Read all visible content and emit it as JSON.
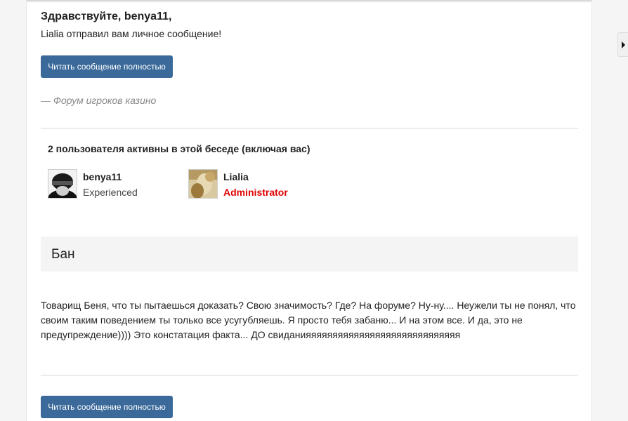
{
  "email": {
    "greeting": "Здравствуйте, benya11,",
    "intro": "Lialia отправил вам личное сообщение!",
    "read_button_label": "Читать сообщение полностью",
    "signature": "— Форум игроков казино"
  },
  "participants": {
    "title": "2 пользователя активны в этой беседе (включая вас)",
    "users": [
      {
        "name": "benya11",
        "title": "Experienced"
      },
      {
        "name": "Lialia",
        "title": "Administrator"
      }
    ]
  },
  "message": {
    "subject": "Бан",
    "body": "Товарищ Беня, что ты пытаешься доказать? Свою значимость? Где? На форуме? Ну-ну.... Неужели ты не понял, что своим таким поведением ты только все усугубляешь. Я просто тебя забаню... И на этом все. И да, это не предупреждение)))) Это констатация факта... ДО свиданияяяяяяяяяяяяяяяяяяяяяяяяяяяяя"
  },
  "colors": {
    "button_bg": "#3b6a9a",
    "admin_title": "#e00000",
    "signature": "#888888"
  },
  "icons": {
    "side_tab": "chevron-right-icon"
  }
}
